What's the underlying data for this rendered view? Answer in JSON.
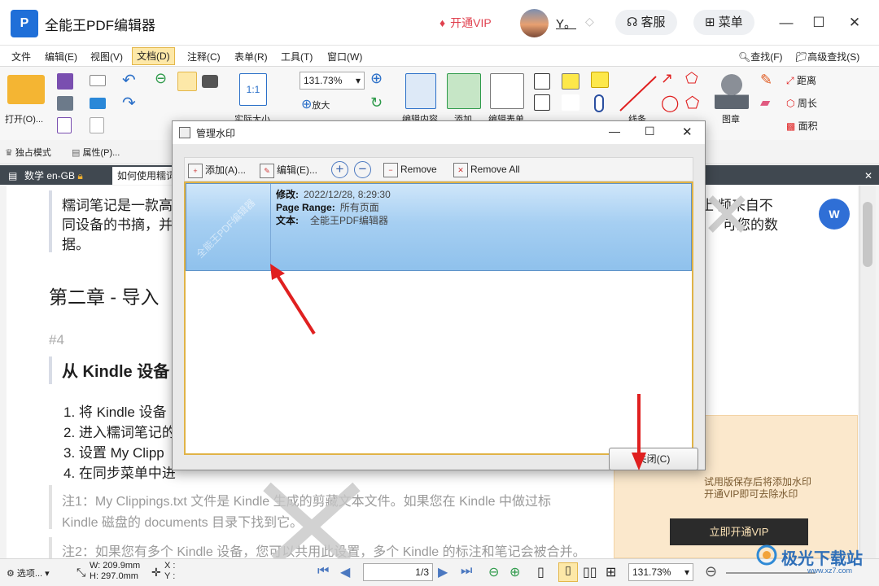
{
  "app": {
    "logo_letter": "P",
    "title": "全能王PDF编辑器",
    "vip_label": "开通VIP",
    "user_name": "Y。",
    "service_label": "客服",
    "menu_label": "菜单",
    "min_icon": "—",
    "max_icon": "☐",
    "close_icon": "✕"
  },
  "menubar": {
    "items": [
      "文件",
      "编辑(E)",
      "视图(V)",
      "文档(D)",
      "注释(C)",
      "表单(R)",
      "工具(T)",
      "窗口(W)"
    ],
    "find": "查找(F)",
    "advanced_find": "高级查找(S)"
  },
  "ribbon": {
    "open": "打开(O)...",
    "zoom_value": "131.73%",
    "zoom_in": "放大",
    "actual_size": "实际大小",
    "edit_content": "编辑内容",
    "add": "添加",
    "edit_form": "编辑表单",
    "line": "线条",
    "stamp": "图章",
    "distance": "距离",
    "perimeter": "周长",
    "area": "面积",
    "exclusive_mode": "独占模式",
    "properties": "属性(P)..."
  },
  "tabs": [
    "数学 en-GB",
    "如何使用糯词"
  ],
  "document": {
    "para1_line1": "糯词笔记是一款高",
    "para1_line1_right": "止  频来自不",
    "para1_line2": "同设备的书摘，并",
    "para1_line2_right": "可您的数",
    "para1_line3": "据。",
    "chapter": "第二章 - 导入",
    "section_num": "#4",
    "heading": "从 Kindle 设备",
    "list": [
      "1. 将 Kindle 设备",
      "2. 进入糯词笔记的",
      "3. 设置 My Clipp",
      "4. 在同步菜单中进"
    ],
    "note1_line1": "注1：My Clippings.txt 文件是 Kindle 生成的剪藏文本文件。如果您在 Kindle 中做过标",
    "note1_line2": "Kindle 磁盘的 documents 目录下找到它。",
    "note2": "注2：如果您有多个 Kindle 设备，您可以共用此设置，多个 Kindle 的标注和笔记会被合并。",
    "float_icon": "W"
  },
  "vip_panel": {
    "note_line1": "试用版保存后将添加水印",
    "note_line2": "开通VIP即可去除水印",
    "button": "立即开通VIP"
  },
  "statusbar": {
    "options": "选项...",
    "width": "W: 209.9mm",
    "height": "H: 297.0mm",
    "x": "X :",
    "y": "Y :",
    "page": "1",
    "page_total": "3",
    "zoom": "131.73%"
  },
  "dialog": {
    "title": "管理水印",
    "add": "添加(A)...",
    "edit": "编辑(E)...",
    "remove": "Remove",
    "remove_all": "Remove All",
    "entry": {
      "modified_label": "修改:",
      "modified_value": "2022/12/28, 8:29:30",
      "page_range_label": "Page Range:",
      "page_range_value": "所有页面",
      "text_label": "文本:",
      "text_value": "全能王PDF编辑器",
      "thumb_watermark": "全能王PDF编辑器"
    },
    "close": "关闭(C)"
  },
  "site_watermark": "极光下载站",
  "site_watermark_url": "www.xz7.com",
  "colors": {
    "vip_red": "#e0404e",
    "selection_blue": "#9ccaf0",
    "arrow_red": "#e02020",
    "tab_bar": "#404850"
  }
}
